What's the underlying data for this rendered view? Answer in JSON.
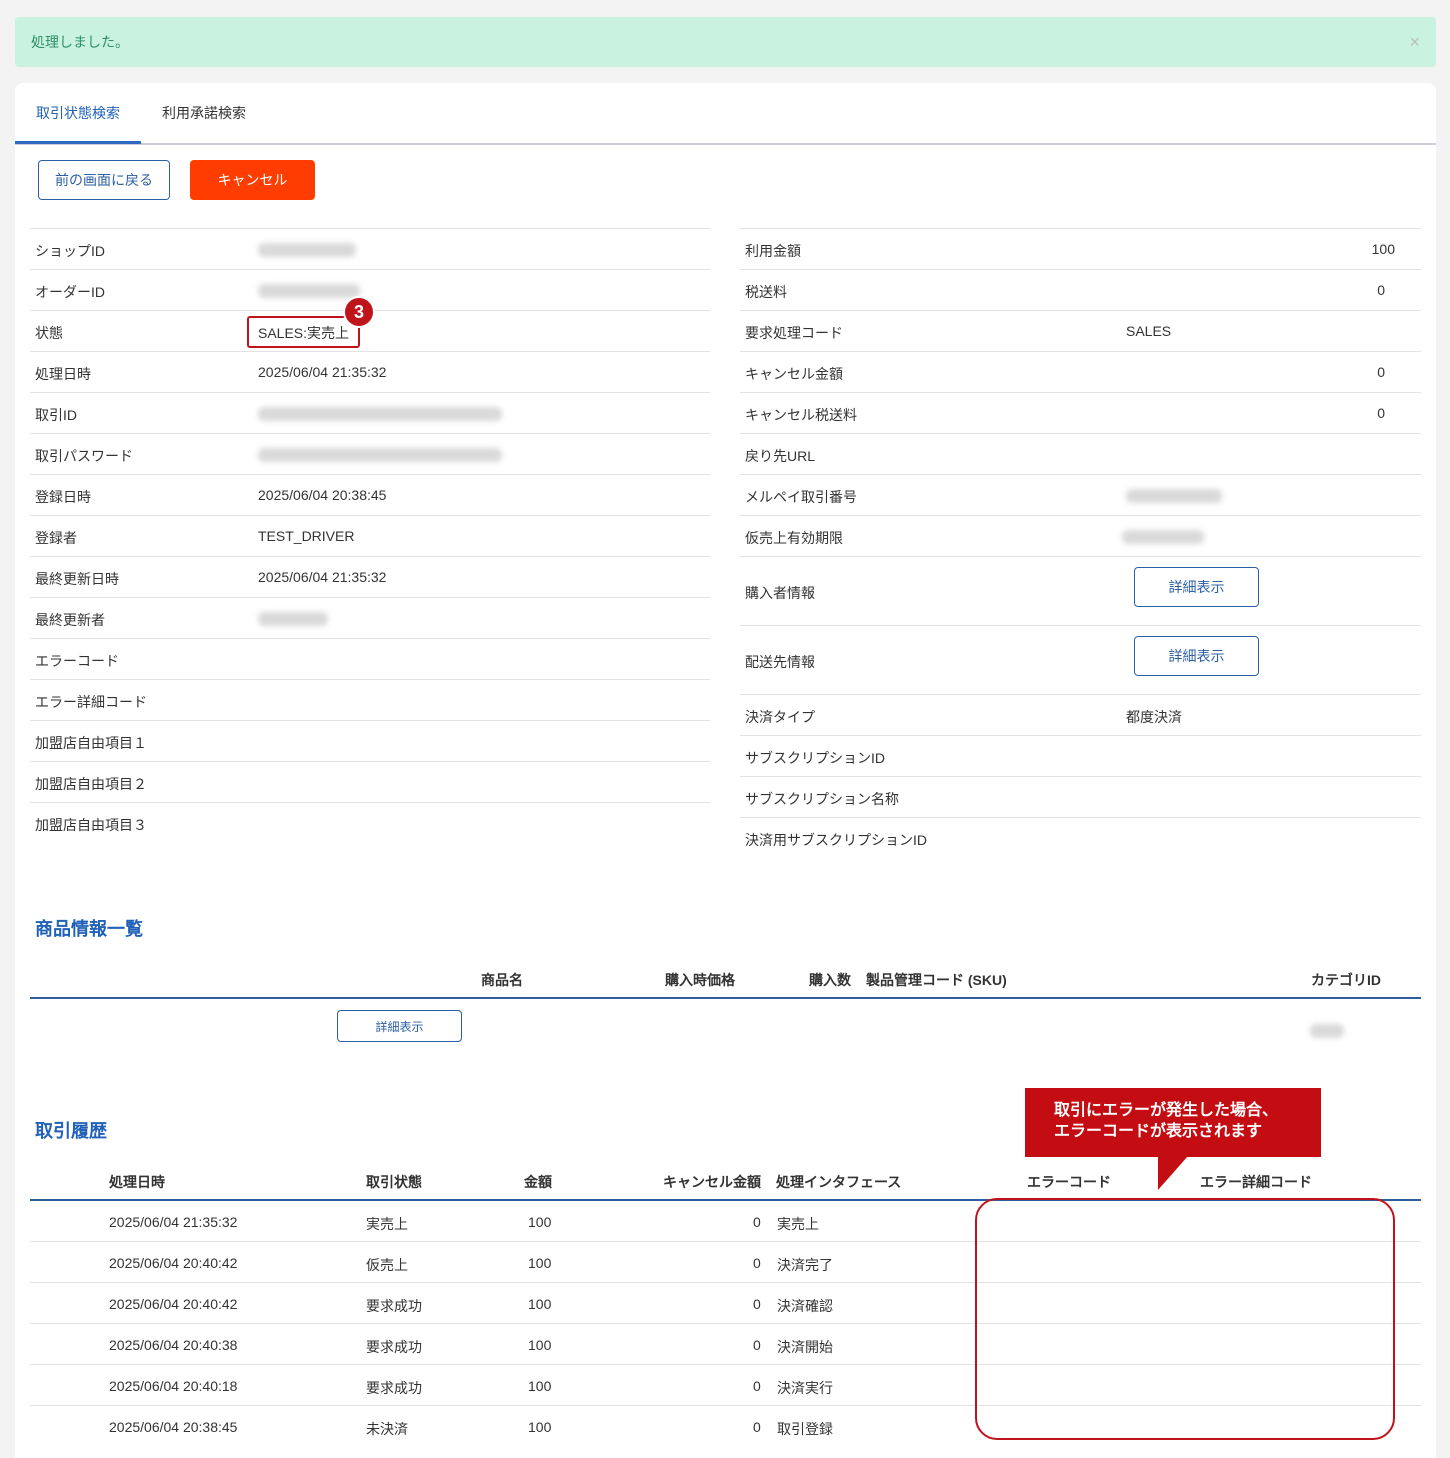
{
  "alert": {
    "message": "処理しました。",
    "close": "×"
  },
  "tabs": [
    {
      "label": "取引状態検索"
    },
    {
      "label": "利用承諾検索"
    }
  ],
  "buttons": {
    "back": "前の画面に戻る",
    "cancel": "キャンセル",
    "detail": "詳細表示"
  },
  "left_fields": [
    {
      "label": "ショップID",
      "value": ""
    },
    {
      "label": "オーダーID",
      "value": ""
    },
    {
      "label": "状態",
      "value": "SALES:実売上"
    },
    {
      "label": "処理日時",
      "value": "2025/06/04 21:35:32"
    },
    {
      "label": "取引ID",
      "value": ""
    },
    {
      "label": "取引パスワード",
      "value": ""
    },
    {
      "label": "登録日時",
      "value": "2025/06/04 20:38:45"
    },
    {
      "label": "登録者",
      "value": "TEST_DRIVER"
    },
    {
      "label": "最終更新日時",
      "value": "2025/06/04 21:35:32"
    },
    {
      "label": "最終更新者",
      "value": ""
    },
    {
      "label": "エラーコード",
      "value": ""
    },
    {
      "label": "エラー詳細コード",
      "value": ""
    },
    {
      "label": "加盟店自由項目１",
      "value": ""
    },
    {
      "label": "加盟店自由項目２",
      "value": ""
    },
    {
      "label": "加盟店自由項目３",
      "value": ""
    }
  ],
  "right_fields": [
    {
      "label": "利用金額",
      "value": "100"
    },
    {
      "label": "税送料",
      "value": "0"
    },
    {
      "label": "要求処理コード",
      "value": "SALES"
    },
    {
      "label": "キャンセル金額",
      "value": "0"
    },
    {
      "label": "キャンセル税送料",
      "value": "0"
    },
    {
      "label": "戻り先URL",
      "value": ""
    },
    {
      "label": "メルペイ取引番号",
      "value": ""
    },
    {
      "label": "仮売上有効期限",
      "value": ""
    },
    {
      "label": "購入者情報",
      "value": ""
    },
    {
      "label": "配送先情報",
      "value": ""
    },
    {
      "label": "決済タイプ",
      "value": "都度決済"
    },
    {
      "label": "サブスクリプションID",
      "value": ""
    },
    {
      "label": "サブスクリプション名称",
      "value": ""
    },
    {
      "label": "決済用サブスクリプションID",
      "value": ""
    }
  ],
  "annotation": {
    "step": "3",
    "callout_line1": "取引にエラーが発生した場合、",
    "callout_line2": "エラーコードが表示されます"
  },
  "products": {
    "title": "商品情報一覧",
    "headers": [
      "商品名",
      "購入時価格",
      "購入数",
      "製品管理コード (SKU)",
      "カテゴリID"
    ]
  },
  "history": {
    "title": "取引履歴",
    "headers": [
      "処理日時",
      "取引状態",
      "金額",
      "キャンセル金額",
      "処理インタフェース",
      "エラーコード",
      "エラー詳細コード"
    ],
    "rows": [
      {
        "date": "2025/06/04 21:35:32",
        "status": "実売上",
        "amount": "100",
        "cancel": "0",
        "iface": "実売上"
      },
      {
        "date": "2025/06/04 20:40:42",
        "status": "仮売上",
        "amount": "100",
        "cancel": "0",
        "iface": "決済完了"
      },
      {
        "date": "2025/06/04 20:40:42",
        "status": "要求成功",
        "amount": "100",
        "cancel": "0",
        "iface": "決済確認"
      },
      {
        "date": "2025/06/04 20:40:38",
        "status": "要求成功",
        "amount": "100",
        "cancel": "0",
        "iface": "決済開始"
      },
      {
        "date": "2025/06/04 20:40:18",
        "status": "要求成功",
        "amount": "100",
        "cancel": "0",
        "iface": "決済実行"
      },
      {
        "date": "2025/06/04 20:38:45",
        "status": "未決済",
        "amount": "100",
        "cancel": "0",
        "iface": "取引登録"
      }
    ]
  },
  "colors": {
    "accent": "#2161b8",
    "danger": "#ff3d00",
    "annotation": "#c0141b",
    "alert_bg": "#c9f3e0"
  }
}
